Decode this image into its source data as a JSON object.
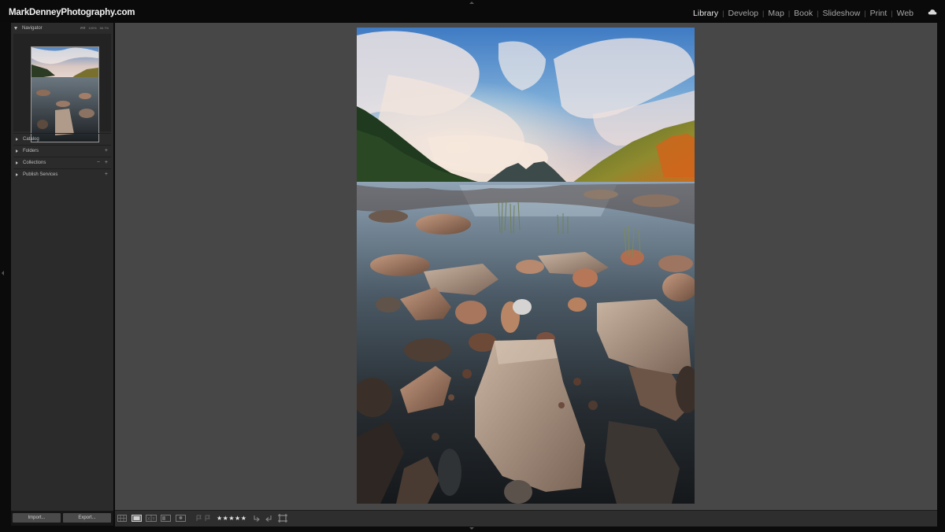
{
  "brand": "MarkDenneyPhotography.com",
  "modules": [
    {
      "label": "Library",
      "active": true
    },
    {
      "label": "Develop",
      "active": false
    },
    {
      "label": "Map",
      "active": false
    },
    {
      "label": "Book",
      "active": false
    },
    {
      "label": "Slideshow",
      "active": false
    },
    {
      "label": "Print",
      "active": false
    },
    {
      "label": "Web",
      "active": false
    }
  ],
  "navigator": {
    "title": "Navigator",
    "zoom_options": [
      "FIT",
      "100%",
      "66.7%"
    ]
  },
  "sections": {
    "catalog": "Catalog",
    "folders": "Folders",
    "collections": "Collections",
    "publish": "Publish Services"
  },
  "symbols": {
    "plus": "+",
    "minus": "−"
  },
  "buttons": {
    "import": "Import...",
    "export": "Export..."
  },
  "toolbar": {
    "rating": "★★★★★"
  },
  "colors": {
    "accent_active": "#e8e8e8",
    "panel_bg": "#2b2b2b",
    "view_bg": "#474747"
  }
}
